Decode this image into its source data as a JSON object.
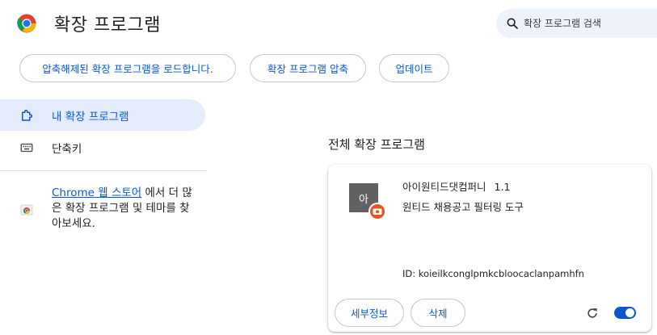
{
  "header": {
    "title": "확장 프로그램",
    "search_placeholder": "확장 프로그램 검색"
  },
  "toolbar": {
    "load_unpacked": "압축해제된 확장 프로그램을 로드합니다.",
    "pack": "확장 프로그램 압축",
    "update": "업데이트"
  },
  "sidebar": {
    "items": [
      {
        "label": "내 확장 프로그램",
        "icon": "puzzle-icon",
        "active": true
      },
      {
        "label": "단축키",
        "icon": "keyboard-icon",
        "active": false
      }
    ],
    "webstore": {
      "link": "Chrome 웹 스토어",
      "text": " 에서 더 많은 확장 프로그램 및 테마를 찾아보세요."
    }
  },
  "main": {
    "section_title": "전체 확장 프로그램",
    "extension": {
      "icon_text": "아",
      "name": "아이원티드댓컴퍼니",
      "version": "1.1",
      "description": "원티드 채용공고 필터링 도구",
      "id": "ID: koieilkconglpmkcbloocaclanpamhfn",
      "enabled": true,
      "details_label": "세부정보",
      "remove_label": "삭제"
    }
  },
  "colors": {
    "accent": "#0b57d0",
    "active_bg": "#e4ecfb",
    "search_bg": "#eef2f9",
    "badge": "#e8531f"
  }
}
